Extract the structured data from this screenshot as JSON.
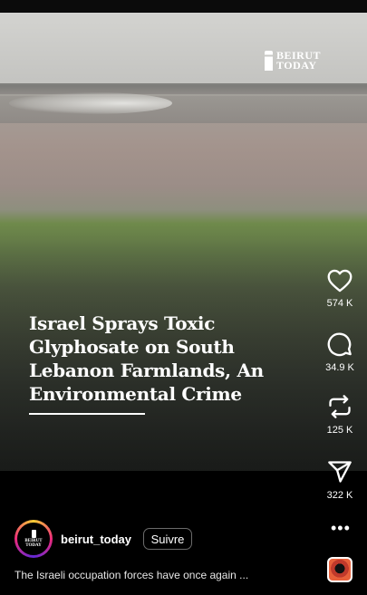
{
  "video": {
    "brand_logo_line1": "BEIRUT",
    "brand_logo_line2": "TODAY",
    "headline_lines": [
      "Israel Sprays Toxic",
      "Glyphosate on South",
      "Lebanon Farmlands, An",
      "Environmental Crime"
    ]
  },
  "actions": {
    "like_count": "574 K",
    "comment_count": "34.9 K",
    "repost_count": "125 K",
    "share_count": "322 K",
    "more_label": "•••"
  },
  "author": {
    "avatar_line1": "BEIRUT",
    "avatar_line2": "TODAY",
    "username": "beirut_today",
    "follow_label": "Suivre"
  },
  "caption": "The Israeli occupation forces have once again ...",
  "icons": [
    "heart-icon",
    "comment-icon",
    "repost-icon",
    "send-icon",
    "more-icon",
    "audio-track-icon"
  ],
  "colors": {
    "background": "#000000",
    "text": "#ffffff",
    "follow_border": "#6b6b6b"
  }
}
